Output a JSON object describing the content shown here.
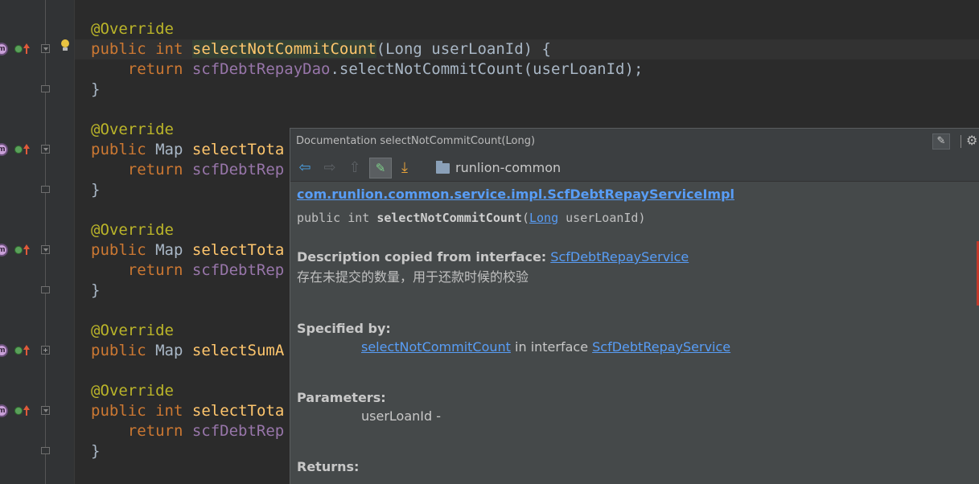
{
  "editor": {
    "lines": [
      {
        "annotation": "@Override"
      },
      {
        "kw1": "public",
        "kw2": "int",
        "name": "selectNotCommitCount",
        "rest": "(Long userLoanId) {"
      },
      {
        "kw": "return",
        "field": "scfDebtRepayDao",
        "rest": ".selectNotCommitCount(userLoanId);"
      },
      {
        "text": "}"
      },
      {
        "annotation": "@Override"
      },
      {
        "kw1": "public",
        "type": "Map",
        "name": "selectTota"
      },
      {
        "kw": "return",
        "field": "scfDebtRep"
      },
      {
        "text": "}"
      },
      {
        "annotation": "@Override"
      },
      {
        "kw1": "public",
        "type": "Map",
        "name": "selectTota"
      },
      {
        "kw": "return",
        "field": "scfDebtRep"
      },
      {
        "text": "}"
      },
      {
        "annotation": "@Override"
      },
      {
        "kw1": "public",
        "type": "Map",
        "name": "selectSumA"
      },
      {
        "annotation": "@Override"
      },
      {
        "kw1": "public",
        "kw2": "int",
        "name": "selectTota"
      },
      {
        "kw": "return",
        "field": "scfDebtRep"
      },
      {
        "text": "}"
      }
    ]
  },
  "gutter_icons": {
    "method_letter": "m"
  },
  "doc_popup": {
    "title": "Documentation selectNotCommitCount(Long)",
    "toolbar": {
      "back_icon": "arrow-left-icon",
      "forward_icon": "arrow-right-icon",
      "up_icon": "arrow-up-icon",
      "edit_icon": "edit-source-icon",
      "down_icon": "arrow-down-icon",
      "module": "runlion-common"
    },
    "class_link": "com.runlion.common.service.impl.ScfDebtRepayServiceImpl",
    "signature": {
      "prefix": "public int ",
      "method": "selectNotCommitCount",
      "open": "(",
      "param_type": "Long",
      "param_rest": " userLoanId)"
    },
    "description_heading": "Description copied from interface:",
    "description_interface": "ScfDebtRepayService",
    "description_text": "存在未提交的数量，用于还款时候的校验",
    "specified_by_heading": "Specified by:",
    "specified_method": "selectNotCommitCount",
    "specified_in": " in interface ",
    "specified_interface": "ScfDebtRepayService",
    "parameters_heading": "Parameters:",
    "parameter": "userLoanId -",
    "returns_heading": "Returns:"
  }
}
